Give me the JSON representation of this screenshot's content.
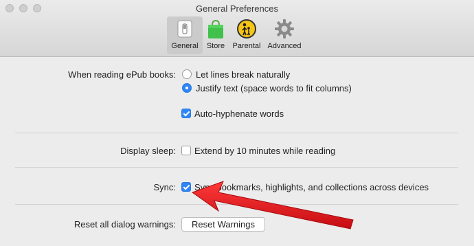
{
  "window": {
    "title": "General Preferences"
  },
  "toolbar": {
    "items": [
      {
        "label": "General",
        "icon": "toggle-switch-icon",
        "selected": true
      },
      {
        "label": "Store",
        "icon": "shopping-bag-icon",
        "selected": false
      },
      {
        "label": "Parental",
        "icon": "parental-controls-icon",
        "selected": false
      },
      {
        "label": "Advanced",
        "icon": "gear-icon",
        "selected": false
      }
    ]
  },
  "epub": {
    "label": "When reading ePub books:",
    "options": [
      {
        "label": "Let lines break naturally",
        "selected": false
      },
      {
        "label": "Justify text (space words to fit columns)",
        "selected": true
      }
    ],
    "hyphenate": {
      "label": "Auto-hyphenate words",
      "checked": true
    }
  },
  "display_sleep": {
    "label": "Display sleep:",
    "option": {
      "label": "Extend by 10 minutes while reading",
      "checked": false
    }
  },
  "sync": {
    "label": "Sync:",
    "option": {
      "label": "Sync bookmarks, highlights, and collections across devices",
      "checked": true
    }
  },
  "reset": {
    "label": "Reset all dialog warnings:",
    "button_label": "Reset Warnings"
  },
  "colors": {
    "accent": "#2f86f6",
    "annotation_arrow": "#e0141b"
  }
}
